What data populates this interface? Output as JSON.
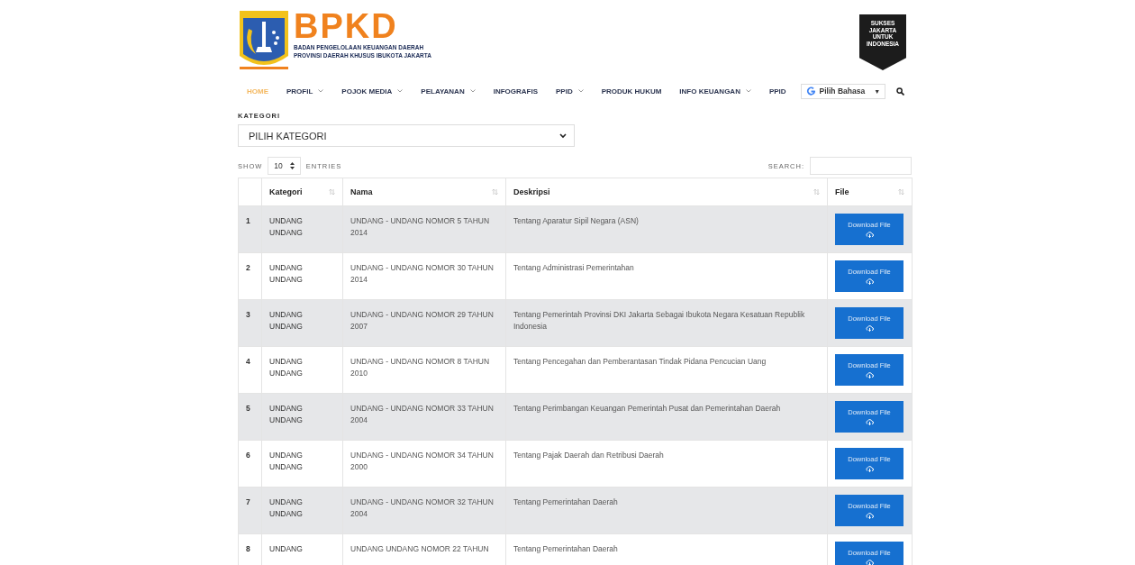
{
  "header": {
    "logo_title": "BPKD",
    "logo_lines": [
      "BADAN PENGELOLAAN KEUANGAN DAERAH",
      "PROVINSI DAERAH KHUSUS IBUKOTA JAKARTA"
    ],
    "badge_lines": [
      "SUKSES",
      "JAKARTA",
      "UNTUK",
      "INDONESIA"
    ]
  },
  "nav": [
    {
      "label": "HOME",
      "selected": true,
      "dropdown": false
    },
    {
      "label": "PROFIL",
      "selected": false,
      "dropdown": true
    },
    {
      "label": "POJOK MEDIA",
      "selected": false,
      "dropdown": true
    },
    {
      "label": "PELAYANAN",
      "selected": false,
      "dropdown": true
    },
    {
      "label": "INFOGRAFIS",
      "selected": false,
      "dropdown": false
    },
    {
      "label": "PPID",
      "selected": false,
      "dropdown": true
    },
    {
      "label": "PRODUK HUKUM",
      "selected": false,
      "dropdown": false
    },
    {
      "label": "INFO KEUANGAN",
      "selected": false,
      "dropdown": true
    },
    {
      "label": "PPID",
      "selected": false,
      "dropdown": false
    }
  ],
  "language": {
    "label": "Pilih Bahasa",
    "arrow": "▼"
  },
  "filter": {
    "label": "KATEGORI",
    "select": "PILIH KATEGORI"
  },
  "entries": {
    "show": "SHOW",
    "count": "10",
    "entries": "ENTRIES",
    "search": "SEARCH:"
  },
  "table": {
    "columns": [
      "",
      "Kategori",
      "Nama",
      "Deskripsi",
      "File"
    ],
    "rows": [
      {
        "no": "1",
        "kategori": "UNDANG UNDANG",
        "nama": "UNDANG - UNDANG NOMOR 5 TAHUN 2014",
        "deskripsi": "Tentang Aparatur Sipil Negara (ASN)",
        "file": "Download File"
      },
      {
        "no": "2",
        "kategori": "UNDANG UNDANG",
        "nama": "UNDANG - UNDANG NOMOR 30 TAHUN 2014",
        "deskripsi": "Tentang Administrasi Pemerintahan",
        "file": "Download File"
      },
      {
        "no": "3",
        "kategori": "UNDANG UNDANG",
        "nama": "UNDANG - UNDANG NOMOR 29 TAHUN 2007",
        "deskripsi": "Tentang Pemerintah Provinsi DKI Jakarta Sebagai Ibukota Negara Kesatuan Republik Indonesia",
        "file": "Download File"
      },
      {
        "no": "4",
        "kategori": "UNDANG UNDANG",
        "nama": "UNDANG - UNDANG NOMOR 8 TAHUN 2010",
        "deskripsi": "Tentang Pencegahan dan Pemberantasan Tindak Pidana Pencucian Uang",
        "file": "Download File"
      },
      {
        "no": "5",
        "kategori": "UNDANG UNDANG",
        "nama": "UNDANG - UNDANG NOMOR 33 TAHUN 2004",
        "deskripsi": "Tentang Perimbangan Keuangan Pemerintah Pusat dan Pemerintahan Daerah",
        "file": "Download File"
      },
      {
        "no": "6",
        "kategori": "UNDANG UNDANG",
        "nama": "UNDANG - UNDANG NOMOR 34 TAHUN 2000",
        "deskripsi": "Tentang Pajak Daerah dan Retribusi Daerah",
        "file": "Download File"
      },
      {
        "no": "7",
        "kategori": "UNDANG UNDANG",
        "nama": "UNDANG - UNDANG NOMOR 32 TAHUN 2004",
        "deskripsi": "Tentang Pemerintahan Daerah",
        "file": "Download File"
      },
      {
        "no": "8",
        "kategori": "UNDANG",
        "nama": "UNDANG UNDANG NOMOR 22 TAHUN",
        "deskripsi": "Tentang Pemerintahan Daerah",
        "file": "Download File"
      }
    ]
  }
}
